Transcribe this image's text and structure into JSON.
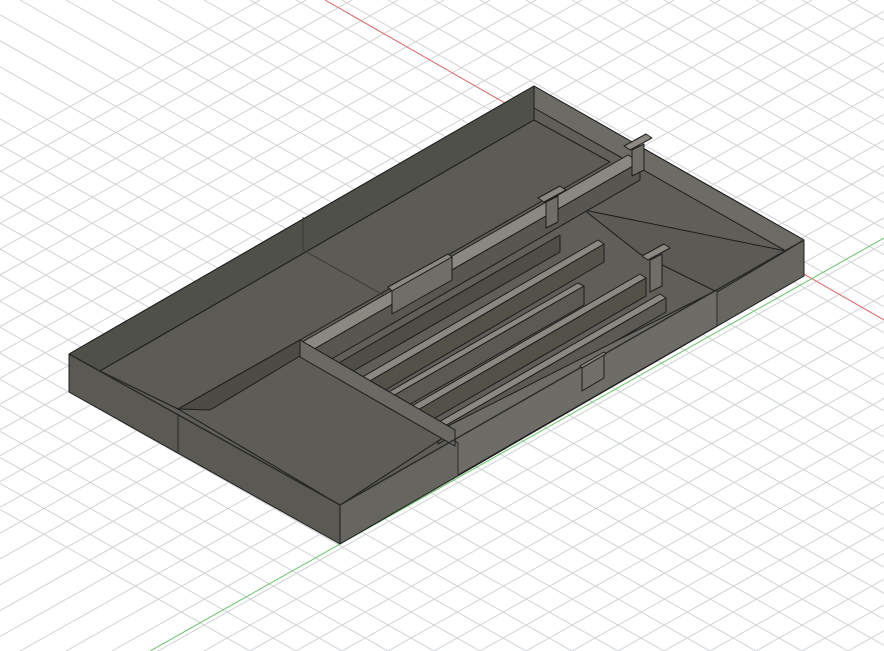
{
  "viewport": {
    "background": "#ffffff",
    "grid_major_color": "#cfd3d6",
    "grid_minor_color": "#e6e8ea",
    "axis_x_color": "#e06060",
    "axis_y_color": "#60c060"
  },
  "model": {
    "name": "drawer-organizer-tray",
    "wall_top_color": "#8a8880",
    "wall_light_color": "#6b6a63",
    "wall_dark_color": "#54534d",
    "floor_color": "#5f5e58",
    "outline_color": "#1a1a1a",
    "compartments": 7,
    "clips": 5
  }
}
